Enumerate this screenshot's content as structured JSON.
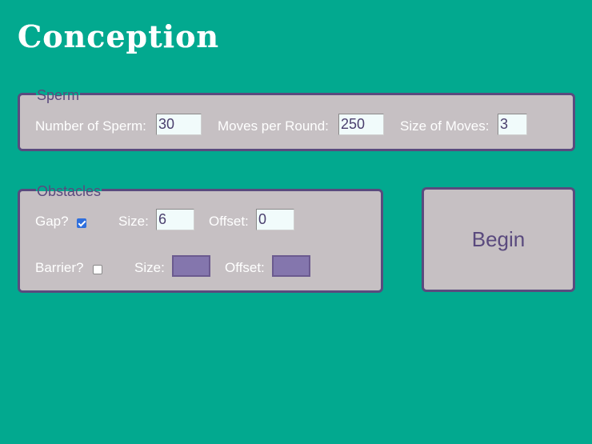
{
  "app": {
    "title": "Conception"
  },
  "sperm_panel": {
    "legend": "Sperm",
    "number_of_sperm": {
      "label": "Number of Sperm:",
      "value": "30"
    },
    "moves_per_round": {
      "label": "Moves per Round:",
      "value": "250"
    },
    "size_of_moves": {
      "label": "Size of Moves:",
      "value": "3"
    }
  },
  "obstacles_panel": {
    "legend": "Obstacles",
    "gap": {
      "label": "Gap?",
      "checked": true,
      "size_label": "Size:",
      "size_value": "6",
      "offset_label": "Offset:",
      "offset_value": "0"
    },
    "barrier": {
      "label": "Barrier?",
      "checked": false,
      "size_label": "Size:",
      "size_value": "",
      "offset_label": "Offset:",
      "offset_value": ""
    }
  },
  "begin_button": {
    "label": "Begin"
  },
  "colors": {
    "background": "#02a98f",
    "panel": "#c6c0c3",
    "border": "#5a4a7e",
    "disabled_input": "#8476ad",
    "checkbox_checked": "#2f6fdd"
  }
}
